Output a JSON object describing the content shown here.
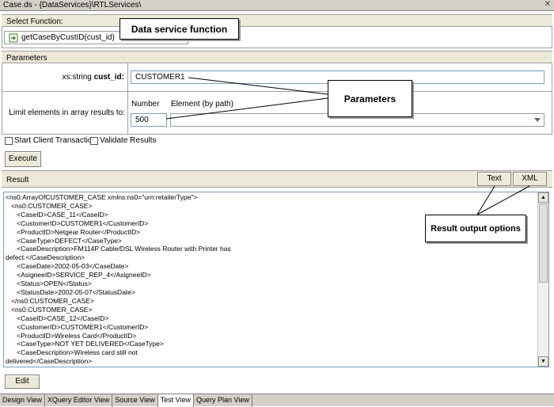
{
  "window": {
    "title": "Case.ds - {DataServices}\\RTLServices\\",
    "close_label": "✕"
  },
  "select_function": {
    "header": "Select Function:",
    "value": "getCaseByCustID(cust_id)"
  },
  "parameters": {
    "header": "Parameters",
    "cust_id": {
      "type_label": "xs:string",
      "name_label": "cust_id:",
      "value": "CUSTOMER1"
    },
    "limit": {
      "label": "Limit elements in array results to:",
      "number_label": "Number",
      "element_label": "Element (by path)",
      "number_value": "500",
      "element_value": ""
    }
  },
  "options": {
    "start_client_transaction": "Start Client Transaction",
    "validate_results": "Validate Results"
  },
  "buttons": {
    "execute": "Execute",
    "edit": "Edit",
    "text": "Text",
    "xml": "XML"
  },
  "result": {
    "header": "Result",
    "lines": [
      "<ns0:ArrayOfCUSTOMER_CASE xmlns:ns0=\"urn:retailerType\">",
      "   <ns0:CUSTOMER_CASE>",
      "      <CaseID>CASE_11</CaseID>",
      "      <CustomerID>CUSTOMER1</CustomerID>",
      "      <ProductID>Netgear Router</ProductID>",
      "      <CaseType>DEFECT</CaseType>",
      "      <CaseDescription>FM114P Cable/DSL Wireless Router with Printer has",
      "defect.</CaseDescription>",
      "      <CaseDate>2002-05-03</CaseDate>",
      "      <AsigneeID>SERVICE_REP_4</AsigneeID>",
      "      <Status>OPEN</Status>",
      "      <StatusDate>2002-05-07</StatusDate>",
      "   </ns0:CUSTOMER_CASE>",
      "   <ns0:CUSTOMER_CASE>",
      "      <CaseID>CASE_12</CaseID>",
      "      <CustomerID>CUSTOMER1</CustomerID>",
      "      <ProductID>Wireless Card</ProductID>",
      "      <CaseType>NOT YET DELIVERED</CaseType>",
      "      <CaseDescription>Wireless card still not",
      "delivered</CaseDescription>"
    ]
  },
  "callouts": {
    "data_service_function": "Data service function",
    "parameters": "Parameters",
    "result_output_options": "Result output options"
  },
  "tabs": [
    "Design View",
    "XQuery Editor View",
    "Source View",
    "Test View",
    "Query Plan View"
  ],
  "active_tab": "Test View"
}
